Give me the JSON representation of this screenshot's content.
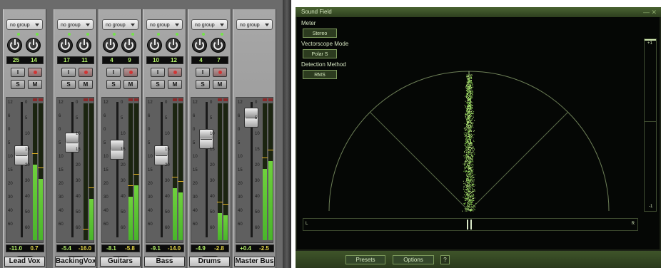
{
  "mixer": {
    "channels": [
      {
        "group": "no group",
        "pan_l": "25",
        "pan_r": "14",
        "insert": "I",
        "solo": "S",
        "mute": "M",
        "vol": "-11.0",
        "peak": "0.7",
        "dyn": "dyn",
        "name": "Lead Vox",
        "fader_level": 0.62,
        "meter_l": 0.55,
        "meter_r": 0.45
      },
      {
        "group": "no group",
        "pan_l": "17",
        "pan_r": "11",
        "insert": "I",
        "solo": "S",
        "mute": "M",
        "vol": "-5.4",
        "peak": "-16.0",
        "dyn": "dyn",
        "name": "BackingVox",
        "fader_level": 0.72,
        "meter_l": 0.0,
        "meter_r": 0.3
      },
      {
        "group": "no group",
        "pan_l": "4",
        "pan_r": "9",
        "insert": "I",
        "solo": "S",
        "mute": "M",
        "vol": "-8.1",
        "peak": "-5.8",
        "dyn": "dyn",
        "name": "Guitars",
        "fader_level": 0.66,
        "meter_l": 0.32,
        "meter_r": 0.4
      },
      {
        "group": "no group",
        "pan_l": "10",
        "pan_r": "12",
        "insert": "I",
        "solo": "S",
        "mute": "M",
        "vol": "-9.1",
        "peak": "-14.0",
        "dyn": "dyn",
        "name": "Bass",
        "fader_level": 0.62,
        "meter_l": 0.38,
        "meter_r": 0.35
      },
      {
        "group": "no group",
        "pan_l": "4",
        "pan_r": "7",
        "insert": "I",
        "solo": "S",
        "mute": "M",
        "vol": "-4.9",
        "peak": "-2.8",
        "dyn": "dyn",
        "name": "Drums",
        "fader_level": 0.75,
        "meter_l": 0.2,
        "meter_r": 0.18
      },
      {
        "group": "no group",
        "vol": "+0.4",
        "peak": "-2.5",
        "name": "Master Bus",
        "fader_level": 0.92,
        "meter_l": 0.52,
        "meter_r": 0.58
      }
    ],
    "fader_scale": [
      "12",
      "6",
      "0",
      "5",
      "10",
      "15",
      "20",
      "30",
      "40",
      "60"
    ],
    "meter_scale": [
      "0",
      "5",
      "10",
      "15",
      "20",
      "30",
      "40",
      "50",
      "60"
    ]
  },
  "soundfield": {
    "title": "Sound Field",
    "meter_label": "Meter",
    "meter_value": "Stereo",
    "vectorscope_label": "Vectorscope Mode",
    "vectorscope_value": "Polar S",
    "detection_label": "Detection Method",
    "detection_value": "RMS",
    "corr_top": "+1",
    "corr_bottom": "-1",
    "lr_left": "L",
    "lr_right": "R",
    "presets": "Presets",
    "options": "Options",
    "help": "?",
    "colors": {
      "accent": "#b6f56a",
      "panel": "#2d3e1e"
    }
  }
}
